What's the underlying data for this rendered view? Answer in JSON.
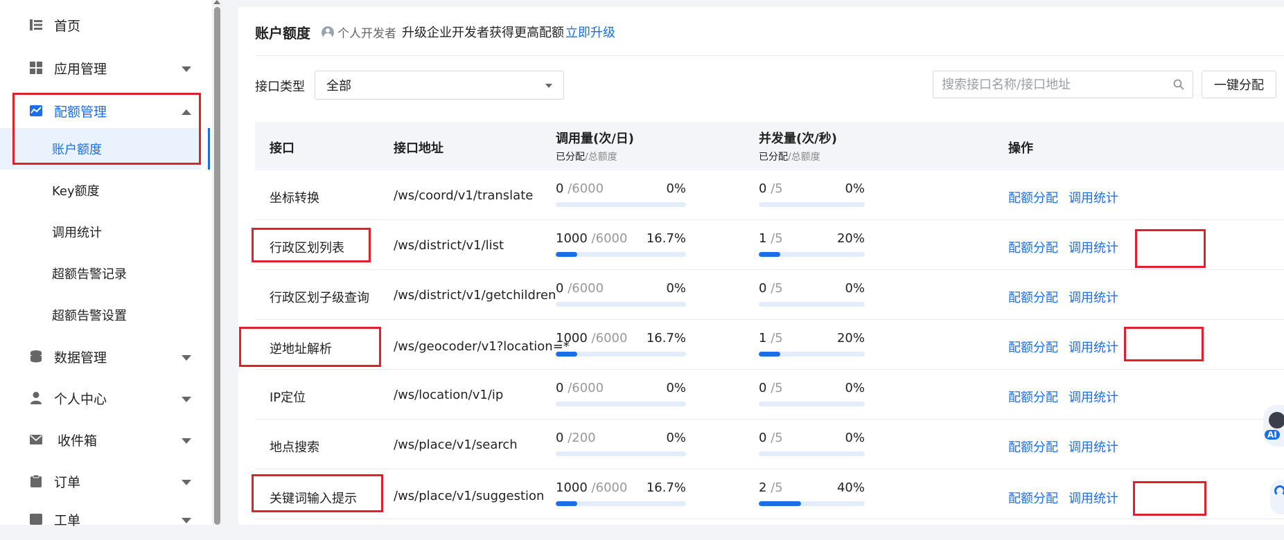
{
  "sidebar": {
    "items": [
      {
        "label": "首页",
        "icon": "list-icon"
      },
      {
        "label": "应用管理",
        "icon": "grid-icon"
      },
      {
        "label": "配额管理",
        "icon": "chart-icon"
      },
      {
        "label": "账户额度"
      },
      {
        "label": "Key额度"
      },
      {
        "label": "调用统计"
      },
      {
        "label": "超额告警记录"
      },
      {
        "label": "超额告警设置"
      },
      {
        "label": "数据管理",
        "icon": "database-icon"
      },
      {
        "label": "个人中心",
        "icon": "user-icon"
      },
      {
        "label": "收件箱",
        "icon": "mail-icon"
      },
      {
        "label": "订单",
        "icon": "clipboard-icon"
      },
      {
        "label": "工单",
        "icon": "ticket-icon"
      }
    ]
  },
  "header": {
    "title": "账户额度",
    "dev_badge": "个人开发者",
    "upgrade_text": "升级企业开发者获得更高配额",
    "upgrade_link": "立即升级"
  },
  "filter": {
    "type_label": "接口类型",
    "type_value": "全部",
    "search_placeholder": "搜索接口名称/接口地址",
    "alloc_button": "一键分配"
  },
  "table": {
    "headers": {
      "api": "接口",
      "url": "接口地址",
      "calls": "调用量(次/日)",
      "concurrency": "并发量(次/秒)",
      "ops": "操作",
      "sub_allocated": "已分配",
      "sub_sep": "/",
      "sub_total": "总额度"
    },
    "ops": {
      "alloc": "配额分配",
      "stats": "调用统计"
    },
    "rows": [
      {
        "api": "坐标转换",
        "url": "/ws/coord/v1/translate",
        "calls_used": "0",
        "calls_total": "/6000",
        "calls_pct": "0%",
        "calls_ratio": 0,
        "conc_used": "0",
        "conc_total": "/5",
        "conc_pct": "0%",
        "conc_ratio": 0
      },
      {
        "api": "行政区划列表",
        "url": "/ws/district/v1/list",
        "calls_used": "1000",
        "calls_total": "/6000",
        "calls_pct": "16.7%",
        "calls_ratio": 0.167,
        "conc_used": "1",
        "conc_total": "/5",
        "conc_pct": "20%",
        "conc_ratio": 0.2
      },
      {
        "api": "行政区划子级查询",
        "url": "/ws/district/v1/getchildren",
        "calls_used": "0",
        "calls_total": "/6000",
        "calls_pct": "0%",
        "calls_ratio": 0,
        "conc_used": "0",
        "conc_total": "/5",
        "conc_pct": "0%",
        "conc_ratio": 0
      },
      {
        "api": "逆地址解析",
        "url": "/ws/geocoder/v1?location=*",
        "calls_used": "1000",
        "calls_total": "/6000",
        "calls_pct": "16.7%",
        "calls_ratio": 0.167,
        "conc_used": "1",
        "conc_total": "/5",
        "conc_pct": "20%",
        "conc_ratio": 0.2
      },
      {
        "api": "IP定位",
        "url": "/ws/location/v1/ip",
        "calls_used": "0",
        "calls_total": "/6000",
        "calls_pct": "0%",
        "calls_ratio": 0,
        "conc_used": "0",
        "conc_total": "/5",
        "conc_pct": "0%",
        "conc_ratio": 0
      },
      {
        "api": "地点搜索",
        "url": "/ws/place/v1/search",
        "calls_used": "0",
        "calls_total": "/200",
        "calls_pct": "0%",
        "calls_ratio": 0,
        "conc_used": "0",
        "conc_total": "/5",
        "conc_pct": "0%",
        "conc_ratio": 0
      },
      {
        "api": "关键词输入提示",
        "url": "/ws/place/v1/suggestion",
        "calls_used": "1000",
        "calls_total": "/6000",
        "calls_pct": "16.7%",
        "calls_ratio": 0.167,
        "conc_used": "2",
        "conc_total": "/5",
        "conc_pct": "40%",
        "conc_ratio": 0.4
      }
    ]
  },
  "floating": {
    "ai_tag": "AI"
  },
  "colors": {
    "accent": "#1c6ee8",
    "highlight": "#e0202a"
  }
}
